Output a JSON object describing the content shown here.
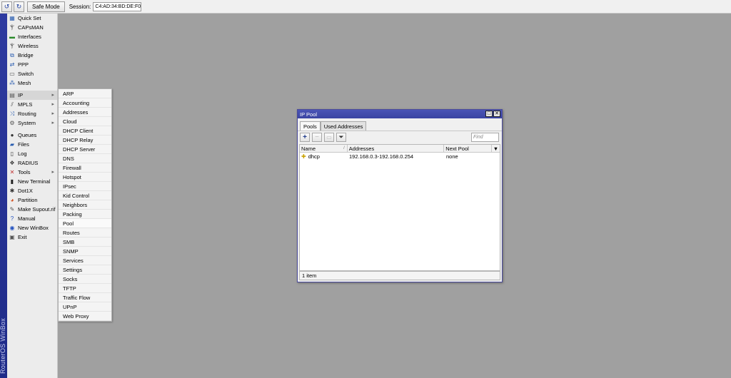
{
  "toolbar": {
    "undo_icon": "undo-icon",
    "redo_icon": "redo-icon",
    "safe_mode_label": "Safe Mode",
    "session_label": "Session:",
    "session_value": "C4:AD:34:BD:DE:F0"
  },
  "brand": {
    "text": "RouterOS WinBox"
  },
  "menu": {
    "items": [
      {
        "label": "Quick Set",
        "icon": "quickset-icon",
        "glyph": "▦",
        "color": "#2a5db0"
      },
      {
        "label": "CAPsMAN",
        "icon": "antenna-icon",
        "glyph": "Ⲯ",
        "color": "#555"
      },
      {
        "label": "Interfaces",
        "icon": "interfaces-icon",
        "glyph": "▬",
        "color": "#2a8a2a"
      },
      {
        "label": "Wireless",
        "icon": "antenna-icon",
        "glyph": "Ⲯ",
        "color": "#555"
      },
      {
        "label": "Bridge",
        "icon": "bridge-icon",
        "glyph": "⧉",
        "color": "#2a5db0"
      },
      {
        "label": "PPP",
        "icon": "ppp-icon",
        "glyph": "⇄",
        "color": "#2a5db0"
      },
      {
        "label": "Switch",
        "icon": "switch-icon",
        "glyph": "▭",
        "color": "#555"
      },
      {
        "label": "Mesh",
        "icon": "mesh-icon",
        "glyph": "⁂",
        "color": "#2a5db0"
      },
      {
        "label": "IP",
        "icon": "ip-icon",
        "glyph": "▤",
        "color": "#555",
        "arrow": true,
        "active": true
      },
      {
        "label": "MPLS",
        "icon": "mpls-icon",
        "glyph": "⫽",
        "color": "#555",
        "arrow": true
      },
      {
        "label": "Routing",
        "icon": "routing-icon",
        "glyph": "⤨",
        "color": "#2a5db0",
        "arrow": true
      },
      {
        "label": "System",
        "icon": "gear-icon",
        "glyph": "⚙",
        "color": "#555",
        "arrow": true
      },
      {
        "label": "Queues",
        "icon": "queues-icon",
        "glyph": "●",
        "color": "#333"
      },
      {
        "label": "Files",
        "icon": "folder-icon",
        "glyph": "▰",
        "color": "#2a5db0"
      },
      {
        "label": "Log",
        "icon": "log-icon",
        "glyph": "▯",
        "color": "#333"
      },
      {
        "label": "RADIUS",
        "icon": "radius-icon",
        "glyph": "❖",
        "color": "#3a3a3a"
      },
      {
        "label": "Tools",
        "icon": "tools-icon",
        "glyph": "✕",
        "color": "#c03030",
        "arrow": true
      },
      {
        "label": "New Terminal",
        "icon": "terminal-icon",
        "glyph": "▮",
        "color": "#222"
      },
      {
        "label": "Dot1X",
        "icon": "dot1x-icon",
        "glyph": "✱",
        "color": "#333"
      },
      {
        "label": "Partition",
        "icon": "partition-icon",
        "glyph": "◕",
        "color": "#d05020"
      },
      {
        "label": "Make Supout.rif",
        "icon": "supout-icon",
        "glyph": "✎",
        "color": "#555"
      },
      {
        "label": "Manual",
        "icon": "help-icon",
        "glyph": "?",
        "color": "#1f4fbf"
      },
      {
        "label": "New WinBox",
        "icon": "winbox-icon",
        "glyph": "◉",
        "color": "#1f4fbf"
      },
      {
        "label": "Exit",
        "icon": "exit-icon",
        "glyph": "▣",
        "color": "#555"
      }
    ]
  },
  "submenu": {
    "items": [
      "ARP",
      "Accounting",
      "Addresses",
      "Cloud",
      "DHCP Client",
      "DHCP Relay",
      "DHCP Server",
      "DNS",
      "Firewall",
      "Hotspot",
      "IPsec",
      "Kid Control",
      "Neighbors",
      "Packing",
      "Pool",
      "Routes",
      "SMB",
      "SNMP",
      "Services",
      "Settings",
      "Socks",
      "TFTP",
      "Traffic Flow",
      "UPnP",
      "Web Proxy"
    ],
    "selected": "Pool"
  },
  "window": {
    "title": "IP Pool",
    "tabs": [
      "Pools",
      "Used Addresses"
    ],
    "find_placeholder": "Find",
    "columns": [
      "Name",
      "Addresses",
      "Next Pool"
    ],
    "rows": [
      {
        "name": "dhcp",
        "addresses": "192.168.0.3-192.168.0.254",
        "next_pool": "none"
      }
    ],
    "status": "1 item"
  }
}
